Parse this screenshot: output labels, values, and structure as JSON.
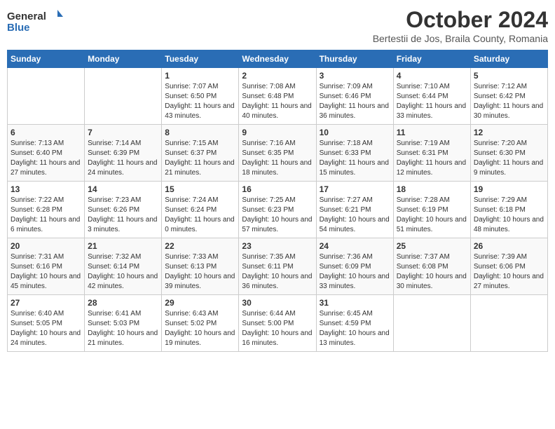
{
  "header": {
    "logo_general": "General",
    "logo_blue": "Blue",
    "month": "October 2024",
    "location": "Bertestii de Jos, Braila County, Romania"
  },
  "weekdays": [
    "Sunday",
    "Monday",
    "Tuesday",
    "Wednesday",
    "Thursday",
    "Friday",
    "Saturday"
  ],
  "weeks": [
    [
      {
        "day": "",
        "info": ""
      },
      {
        "day": "",
        "info": ""
      },
      {
        "day": "1",
        "info": "Sunrise: 7:07 AM\nSunset: 6:50 PM\nDaylight: 11 hours and 43 minutes."
      },
      {
        "day": "2",
        "info": "Sunrise: 7:08 AM\nSunset: 6:48 PM\nDaylight: 11 hours and 40 minutes."
      },
      {
        "day": "3",
        "info": "Sunrise: 7:09 AM\nSunset: 6:46 PM\nDaylight: 11 hours and 36 minutes."
      },
      {
        "day": "4",
        "info": "Sunrise: 7:10 AM\nSunset: 6:44 PM\nDaylight: 11 hours and 33 minutes."
      },
      {
        "day": "5",
        "info": "Sunrise: 7:12 AM\nSunset: 6:42 PM\nDaylight: 11 hours and 30 minutes."
      }
    ],
    [
      {
        "day": "6",
        "info": "Sunrise: 7:13 AM\nSunset: 6:40 PM\nDaylight: 11 hours and 27 minutes."
      },
      {
        "day": "7",
        "info": "Sunrise: 7:14 AM\nSunset: 6:39 PM\nDaylight: 11 hours and 24 minutes."
      },
      {
        "day": "8",
        "info": "Sunrise: 7:15 AM\nSunset: 6:37 PM\nDaylight: 11 hours and 21 minutes."
      },
      {
        "day": "9",
        "info": "Sunrise: 7:16 AM\nSunset: 6:35 PM\nDaylight: 11 hours and 18 minutes."
      },
      {
        "day": "10",
        "info": "Sunrise: 7:18 AM\nSunset: 6:33 PM\nDaylight: 11 hours and 15 minutes."
      },
      {
        "day": "11",
        "info": "Sunrise: 7:19 AM\nSunset: 6:31 PM\nDaylight: 11 hours and 12 minutes."
      },
      {
        "day": "12",
        "info": "Sunrise: 7:20 AM\nSunset: 6:30 PM\nDaylight: 11 hours and 9 minutes."
      }
    ],
    [
      {
        "day": "13",
        "info": "Sunrise: 7:22 AM\nSunset: 6:28 PM\nDaylight: 11 hours and 6 minutes."
      },
      {
        "day": "14",
        "info": "Sunrise: 7:23 AM\nSunset: 6:26 PM\nDaylight: 11 hours and 3 minutes."
      },
      {
        "day": "15",
        "info": "Sunrise: 7:24 AM\nSunset: 6:24 PM\nDaylight: 11 hours and 0 minutes."
      },
      {
        "day": "16",
        "info": "Sunrise: 7:25 AM\nSunset: 6:23 PM\nDaylight: 10 hours and 57 minutes."
      },
      {
        "day": "17",
        "info": "Sunrise: 7:27 AM\nSunset: 6:21 PM\nDaylight: 10 hours and 54 minutes."
      },
      {
        "day": "18",
        "info": "Sunrise: 7:28 AM\nSunset: 6:19 PM\nDaylight: 10 hours and 51 minutes."
      },
      {
        "day": "19",
        "info": "Sunrise: 7:29 AM\nSunset: 6:18 PM\nDaylight: 10 hours and 48 minutes."
      }
    ],
    [
      {
        "day": "20",
        "info": "Sunrise: 7:31 AM\nSunset: 6:16 PM\nDaylight: 10 hours and 45 minutes."
      },
      {
        "day": "21",
        "info": "Sunrise: 7:32 AM\nSunset: 6:14 PM\nDaylight: 10 hours and 42 minutes."
      },
      {
        "day": "22",
        "info": "Sunrise: 7:33 AM\nSunset: 6:13 PM\nDaylight: 10 hours and 39 minutes."
      },
      {
        "day": "23",
        "info": "Sunrise: 7:35 AM\nSunset: 6:11 PM\nDaylight: 10 hours and 36 minutes."
      },
      {
        "day": "24",
        "info": "Sunrise: 7:36 AM\nSunset: 6:09 PM\nDaylight: 10 hours and 33 minutes."
      },
      {
        "day": "25",
        "info": "Sunrise: 7:37 AM\nSunset: 6:08 PM\nDaylight: 10 hours and 30 minutes."
      },
      {
        "day": "26",
        "info": "Sunrise: 7:39 AM\nSunset: 6:06 PM\nDaylight: 10 hours and 27 minutes."
      }
    ],
    [
      {
        "day": "27",
        "info": "Sunrise: 6:40 AM\nSunset: 5:05 PM\nDaylight: 10 hours and 24 minutes."
      },
      {
        "day": "28",
        "info": "Sunrise: 6:41 AM\nSunset: 5:03 PM\nDaylight: 10 hours and 21 minutes."
      },
      {
        "day": "29",
        "info": "Sunrise: 6:43 AM\nSunset: 5:02 PM\nDaylight: 10 hours and 19 minutes."
      },
      {
        "day": "30",
        "info": "Sunrise: 6:44 AM\nSunset: 5:00 PM\nDaylight: 10 hours and 16 minutes."
      },
      {
        "day": "31",
        "info": "Sunrise: 6:45 AM\nSunset: 4:59 PM\nDaylight: 10 hours and 13 minutes."
      },
      {
        "day": "",
        "info": ""
      },
      {
        "day": "",
        "info": ""
      }
    ]
  ]
}
